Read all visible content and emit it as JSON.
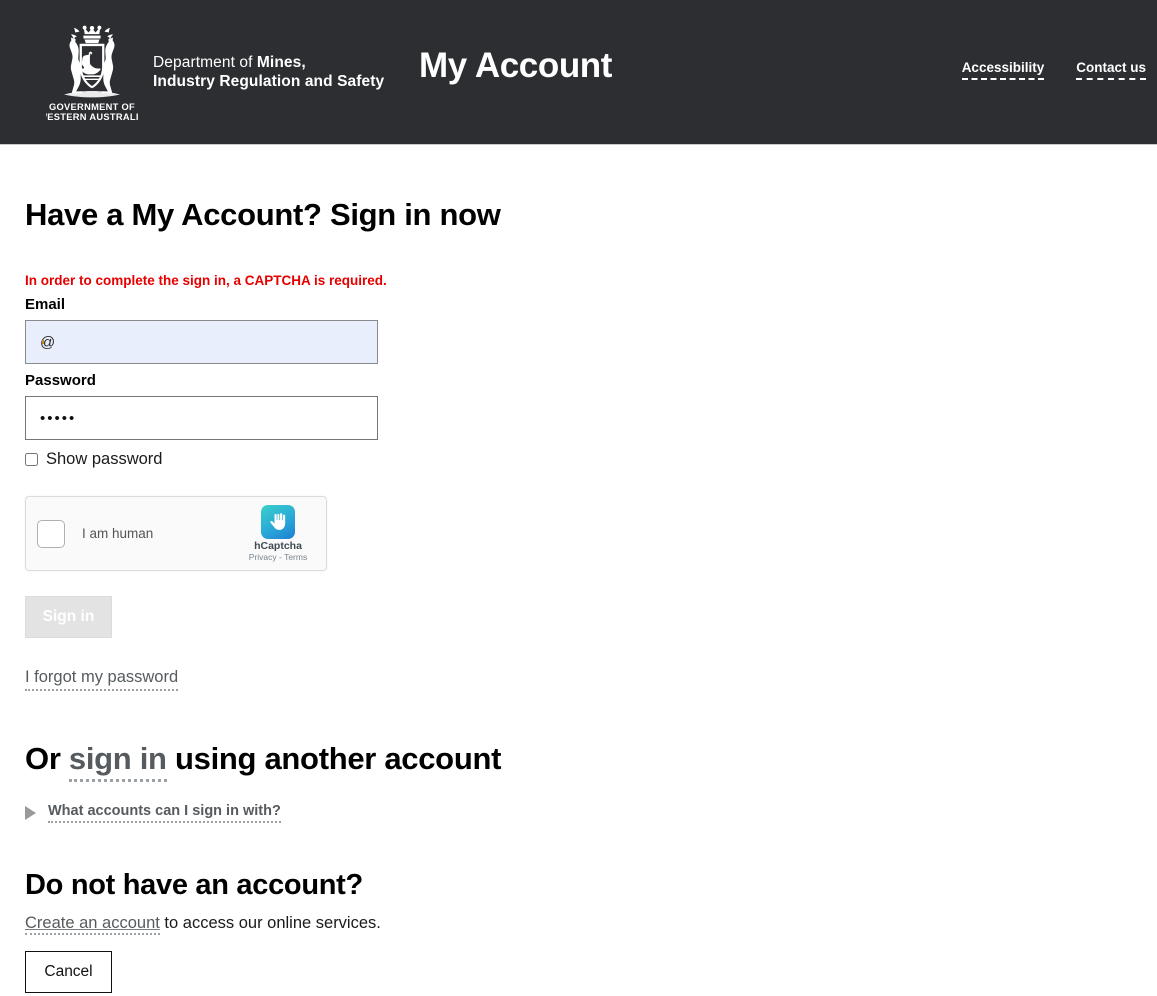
{
  "header": {
    "logo": {
      "crest_icon": "wa-government-crest-icon",
      "line1": "GOVERNMENT OF",
      "line2": "WESTERN AUSTRALIA"
    },
    "department": {
      "line1_light": "Department of ",
      "line1_bold": "Mines,",
      "line2": "Industry Regulation and Safety"
    },
    "app_title": "My Account",
    "links": [
      {
        "label": "Accessibility"
      },
      {
        "label": "Contact us"
      }
    ]
  },
  "main": {
    "page_title": "Have a My Account? Sign in now",
    "error_message": "In order to complete the sign in, a CAPTCHA is required.",
    "email": {
      "label": "Email",
      "value": "@",
      "placeholder": ""
    },
    "password": {
      "label": "Password",
      "value": "•••••",
      "placeholder": "",
      "show_password_label": "Show password",
      "show_password_checked": false
    },
    "captcha": {
      "checkbox_label": "I am human",
      "brand": "hCaptcha",
      "terms": "Privacy - Terms",
      "logo_icon": "hcaptcha-hand-icon",
      "checked": false
    },
    "sign_in_button": "Sign in",
    "sign_in_disabled": true,
    "forgot_password_link": "I forgot my password",
    "other_account": {
      "title_before": "Or ",
      "title_link": "sign in",
      "title_after": " using another account",
      "disclosure_label": "What accounts can I sign in with?",
      "disclosure_expanded": false
    },
    "no_account": {
      "title": "Do not have an account?",
      "link": "Create an account",
      "rest": " to access our online services."
    },
    "cancel_button": "Cancel"
  },
  "colors": {
    "header_bg": "#2c2e31",
    "error_red": "#e60000",
    "autofill_bg": "#e8eefb",
    "link_grey": "#555b5e",
    "disabled_btn": "#e3e3e3"
  }
}
